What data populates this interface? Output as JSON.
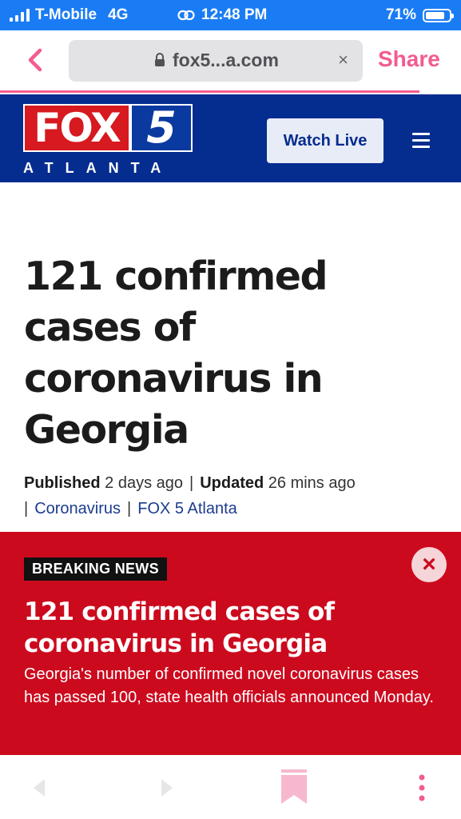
{
  "status_bar": {
    "carrier": "T-Mobile",
    "network": "4G",
    "time": "12:48 PM",
    "battery": "71%"
  },
  "browser": {
    "url": "fox5...a.com",
    "share_label": "Share",
    "clear_label": "×",
    "back_label": "<"
  },
  "site": {
    "logo_fox": "FOX",
    "logo_num": "5",
    "logo_city": "ATLANTA",
    "watch_live_label": "Watch Live",
    "brand_color": "#052c8f"
  },
  "article": {
    "headline": "121 confirmed cases of coronavirus in Georgia",
    "published_label": "Published",
    "published_value": "2 days ago",
    "updated_label": "Updated",
    "updated_value": "26 mins ago",
    "tags": [
      "Coronavirus",
      "FOX 5 Atlanta"
    ]
  },
  "breaking": {
    "badge": "BREAKING NEWS",
    "title": "121 confirmed cases of coronavirus in Georgia",
    "summary": "Georgia's number of confirmed novel coronavirus cases has passed 100, state health officials announced Monday.",
    "close_label": "×",
    "color": "#cc0a1e"
  },
  "accent_color": "#f25c91"
}
